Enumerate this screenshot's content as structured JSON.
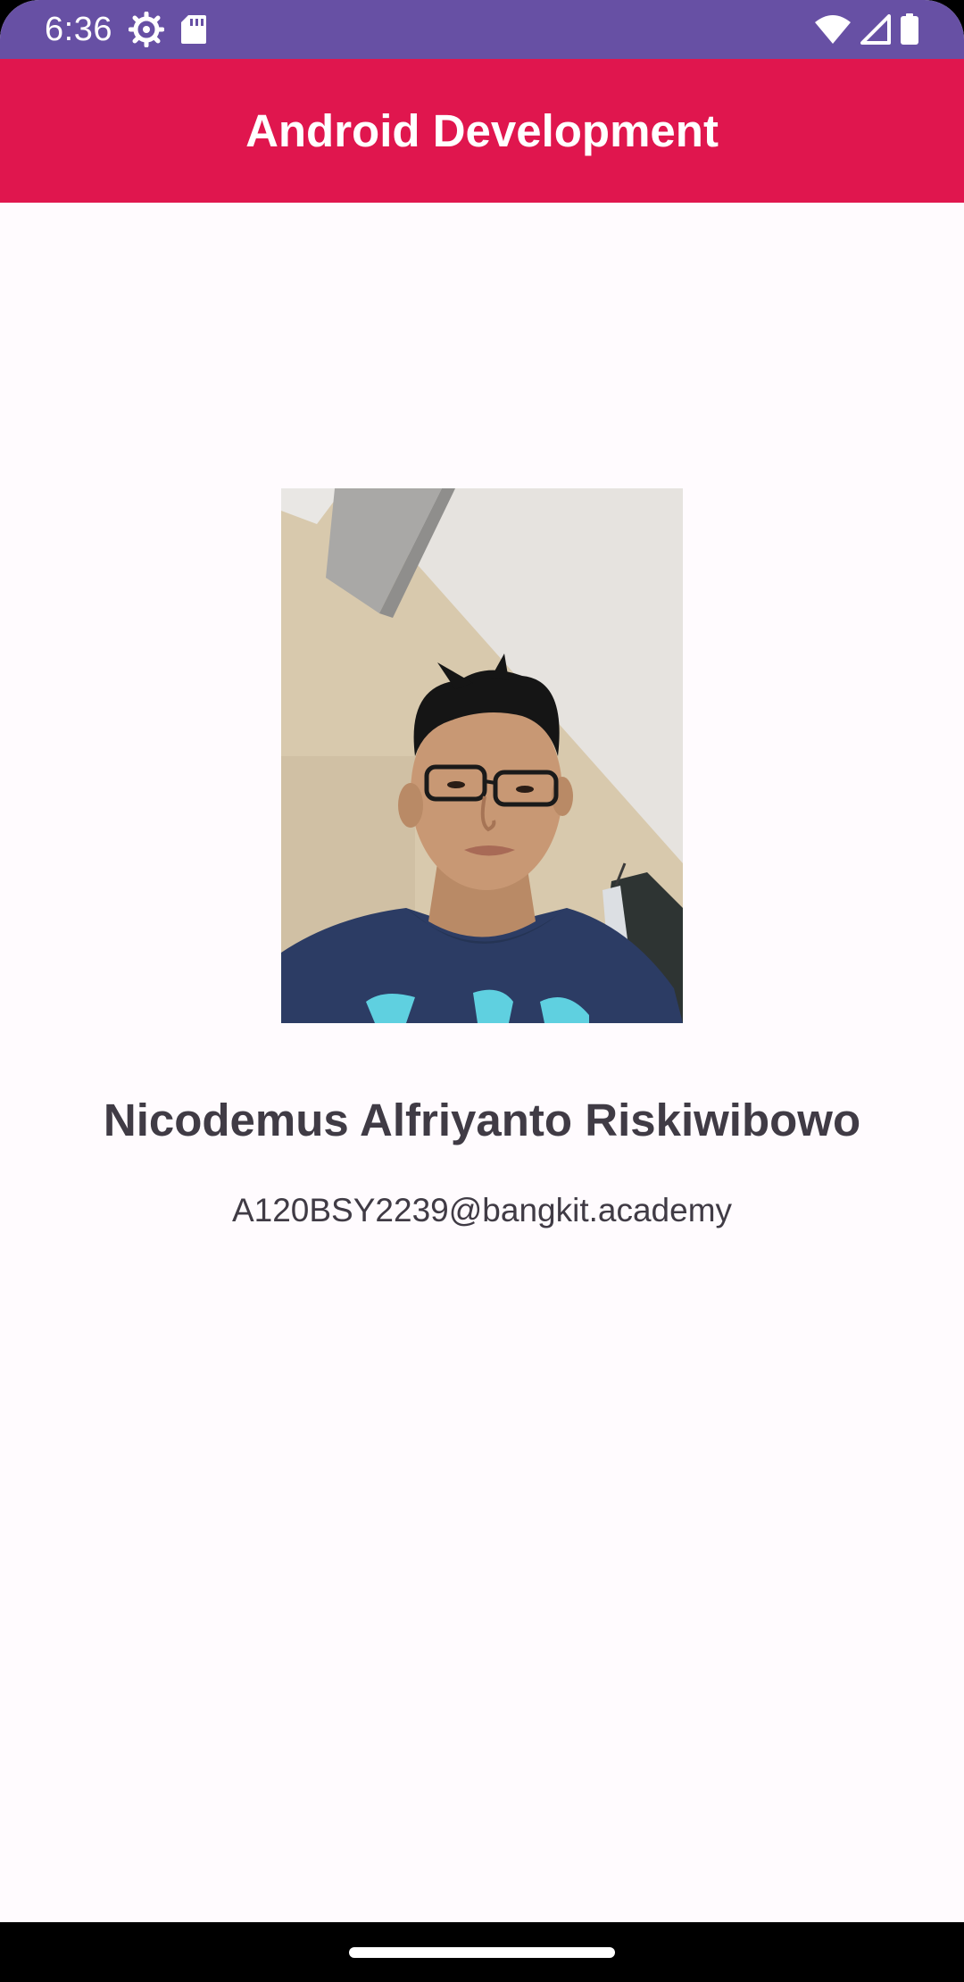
{
  "status_bar": {
    "time": "6:36",
    "icons_left": [
      "settings-gear-icon",
      "sd-card-icon"
    ],
    "icons_right": [
      "wifi-icon",
      "cell-signal-icon",
      "battery-icon"
    ],
    "background_color": "#6750a4"
  },
  "app_bar": {
    "title": "Android Development",
    "background_color": "#e0164e"
  },
  "profile": {
    "photo": "profile-photo",
    "name": "Nicodemus Alfriyanto Riskiwibowo",
    "email": "A120BSY2239@bangkit.academy"
  },
  "navigation_bar": {
    "home_handle": "home-gesture-handle"
  }
}
